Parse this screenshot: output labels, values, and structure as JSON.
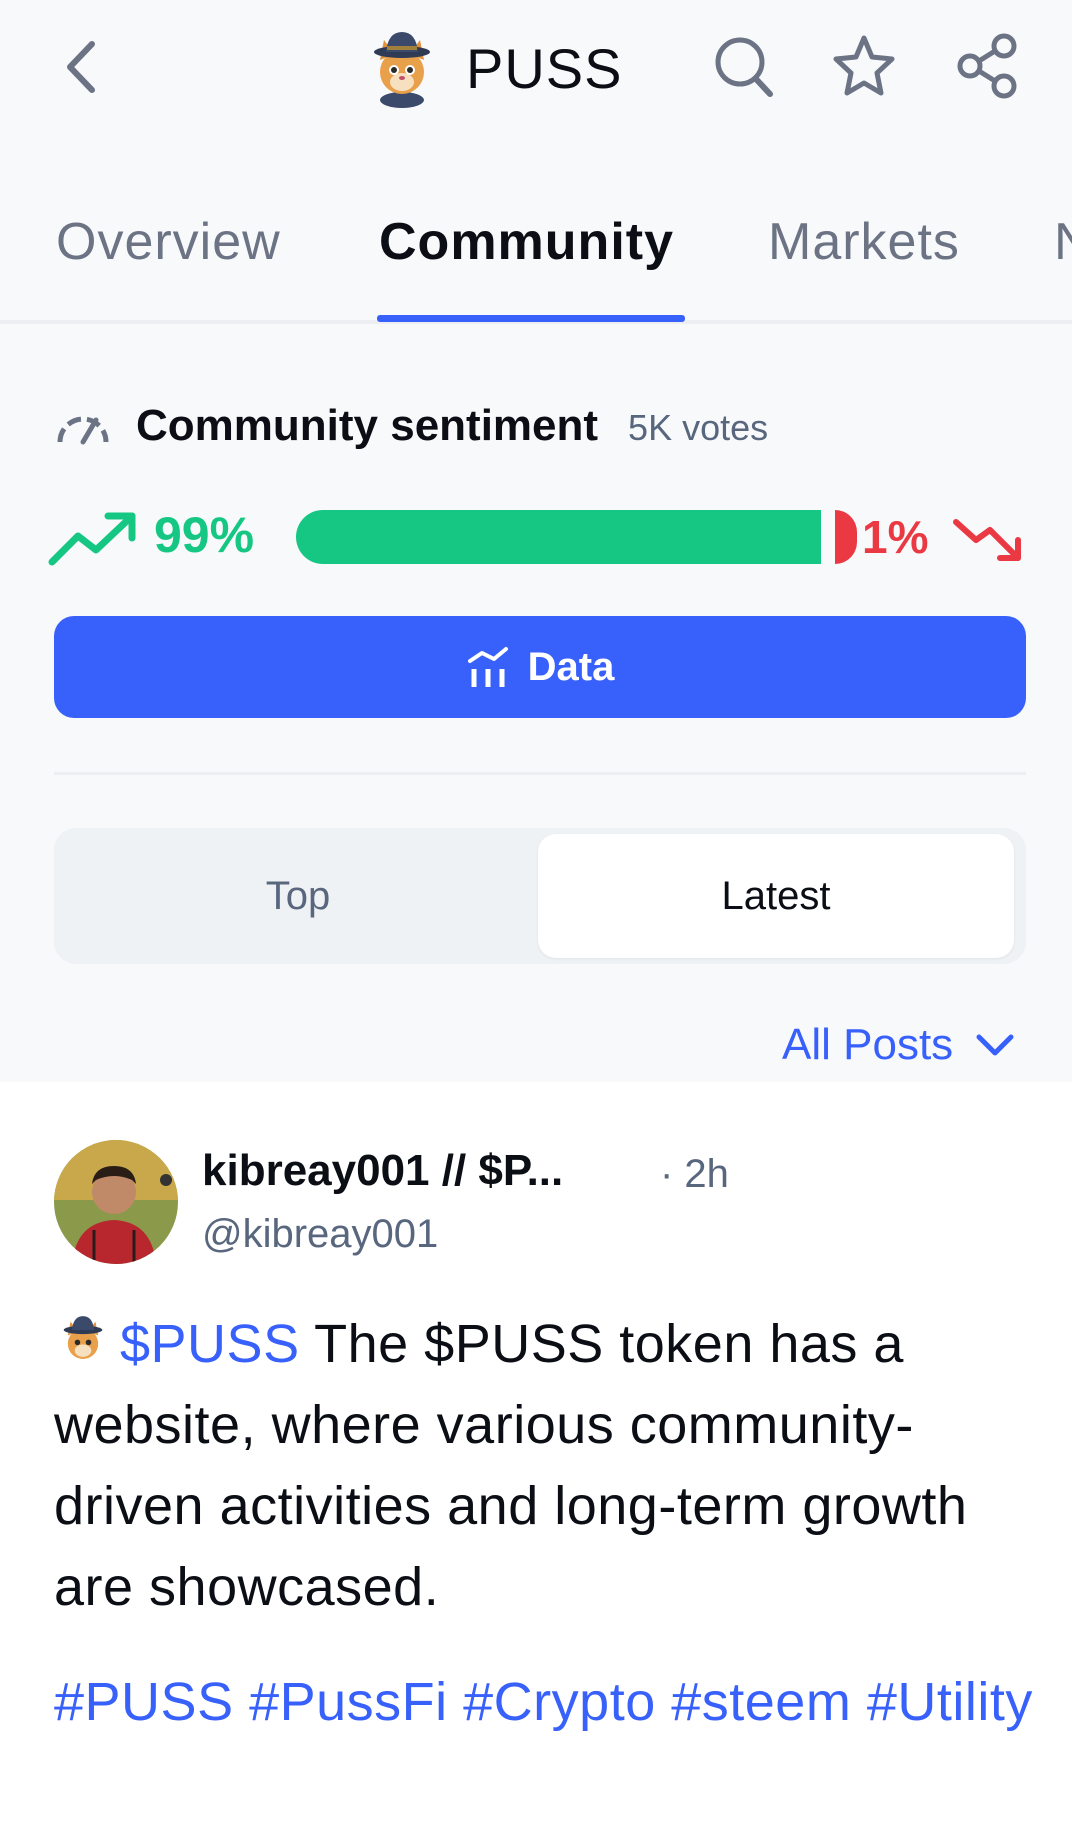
{
  "header": {
    "title": "PUSS",
    "back_icon": "chevron-left-icon",
    "search_icon": "search-icon",
    "star_icon": "star-icon",
    "share_icon": "share-icon"
  },
  "tabs": [
    {
      "label": "Overview",
      "active": false
    },
    {
      "label": "Community",
      "active": true
    },
    {
      "label": "Markets",
      "active": false
    },
    {
      "label": "N",
      "active": false
    }
  ],
  "sentiment": {
    "title": "Community sentiment",
    "votes": "5K votes",
    "bullish_pct": "99%",
    "bearish_pct": "1%",
    "bullish_fraction": 0.99,
    "bullish_color": "#16c784",
    "bearish_color": "#ea3943"
  },
  "data_button": {
    "label": "Data"
  },
  "segment": {
    "options": [
      "Top",
      "Latest"
    ],
    "selected": "Latest"
  },
  "filter": {
    "label": "All Posts"
  },
  "post": {
    "author": "kibreay001 // $P...",
    "time": "· 2h",
    "handle": "@kibreay001",
    "cashtag": "$PUSS",
    "text": " The $PUSS token has a website, where various community-driven activities and long-term growth are showcased.",
    "hashtags": "#PUSS #PussFi #Crypto #steem #Utility"
  },
  "colors": {
    "accent": "#3861fb",
    "text": "#0b0e14",
    "muted": "#58667e"
  }
}
